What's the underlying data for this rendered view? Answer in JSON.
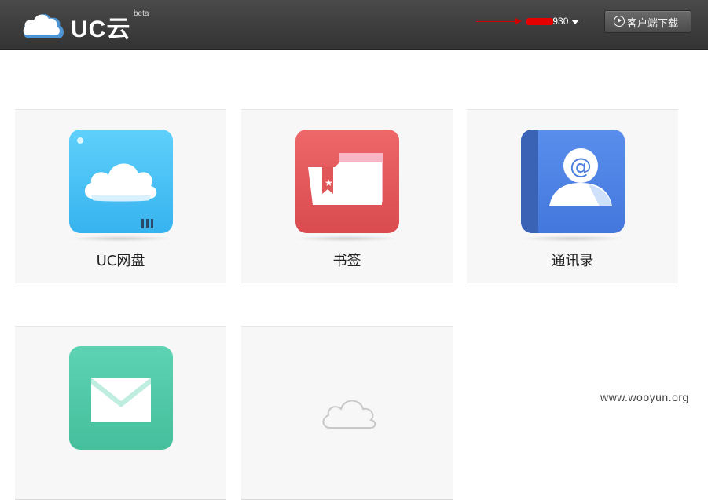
{
  "header": {
    "logo_text": "UC云",
    "logo_badge": "beta",
    "user_name_visible": "930",
    "download_button": "客户端下载"
  },
  "tiles": [
    {
      "label": "UC网盘",
      "icon": "cloud-drive-icon",
      "color": "#45c1f5"
    },
    {
      "label": "书签",
      "icon": "bookmark-folder-icon",
      "color": "#e05557"
    },
    {
      "label": "通讯录",
      "icon": "contacts-icon",
      "color": "#4c7fe0"
    },
    {
      "label": "",
      "icon": "mail-icon",
      "color": "#55c9a8"
    },
    {
      "label": "",
      "icon": "add-cloud-icon",
      "color": "#c8c8c8"
    }
  ],
  "watermark": "www.wooyun.org"
}
